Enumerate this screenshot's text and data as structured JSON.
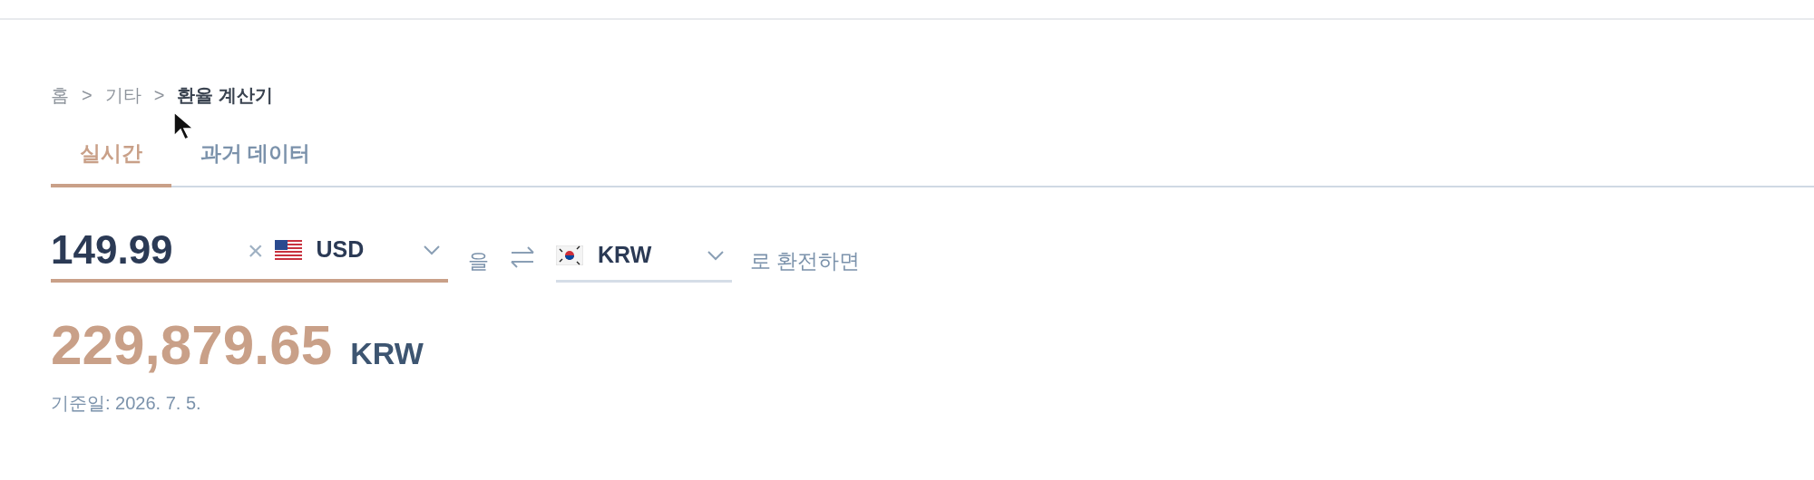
{
  "breadcrumb": [
    {
      "text": "홈",
      "kind": "link"
    },
    {
      "text": ">",
      "kind": "separator"
    },
    {
      "text": "기타",
      "kind": "link"
    },
    {
      "text": ">",
      "kind": "separator"
    },
    {
      "text": "환율 계산기",
      "kind": "current"
    }
  ],
  "tabs": [
    {
      "label": "실시간",
      "selected": true
    },
    {
      "label": "과거 데이터",
      "selected": false
    }
  ],
  "converter": {
    "amount": "149.99",
    "clear": "×",
    "from_currency": "USD",
    "particle": "을",
    "to_currency": "KRW",
    "suffix": "로 환전하면"
  },
  "result": {
    "value": "229,879.65",
    "currency": "KRW",
    "date": "기준일: 2026. 7. 5."
  }
}
